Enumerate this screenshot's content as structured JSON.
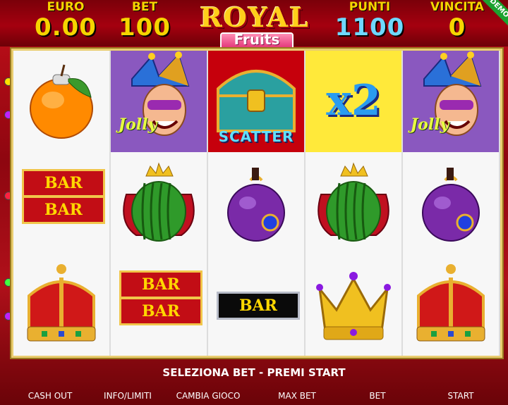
{
  "meters": {
    "euro": {
      "label": "EURO",
      "value": "0.00"
    },
    "bet": {
      "label": "BET",
      "value": "100"
    },
    "punti": {
      "label": "PUNTI",
      "value": "1100"
    },
    "vincita": {
      "label": "VINCITA",
      "value": "0"
    }
  },
  "badge": "DEMO",
  "logo": {
    "line1": "ROYAL",
    "line2": "Fruits"
  },
  "reels": [
    [
      "orange",
      "bar-bar",
      "crown-red"
    ],
    [
      "jolly",
      "watermelon",
      "bar-bar"
    ],
    [
      "scatter",
      "plum",
      "bar"
    ],
    [
      "x2",
      "watermelon",
      "crown-gold"
    ],
    [
      "jolly",
      "plum",
      "crown-red"
    ]
  ],
  "symbols": {
    "bar_text": "BAR",
    "jolly_text": "Jolly",
    "scatter_text": "SCATTER",
    "x2_text": "x2"
  },
  "status_message": "SELEZIONA BET - PREMI START",
  "buttons": {
    "cash_out": "CASH OUT",
    "info": "INFO/LIMITI",
    "change_game": "CAMBIA GIOCO",
    "max_bet": "MAX BET",
    "bet": "BET",
    "start": "START"
  },
  "colors": {
    "meter_yellow": "#f6d400",
    "meter_blue": "#6fd8ff",
    "background_red": "#a5000f",
    "frame_gold": "#e9cd70"
  }
}
